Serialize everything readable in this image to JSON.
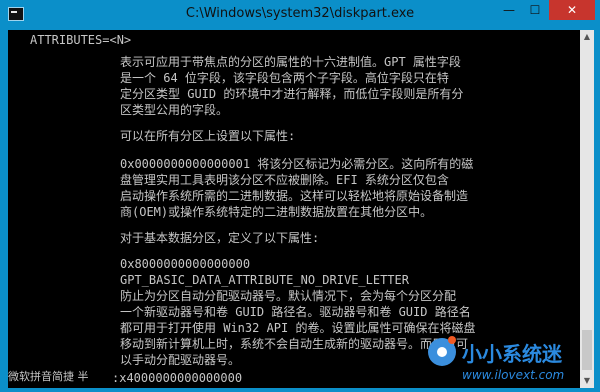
{
  "window": {
    "title": "C:\\Windows\\system32\\diskpart.exe",
    "buttons": {
      "minimize": "—",
      "maximize": "☐",
      "close": "✕"
    }
  },
  "console": {
    "lines": [
      "ATTRIBUTES=<N>",
      "表示可应用于带焦点的分区的属性的十六进制值。GPT 属性字段",
      "是一个 64 位字段，该字段包含两个子字段。高位字段只在特",
      "定分区类型 GUID 的环境中才进行解释，而低位字段则是所有分",
      "区类型公用的字段。",
      "可以在所有分区上设置以下属性:",
      "0x0000000000000001 将该分区标记为必需分区。这向所有的磁",
      "盘管理实用工具表明该分区不应被删除。EFI 系统分区仅包含",
      "启动操作系统所需的二进制数据。这样可以轻松地将原始设备制造",
      "商(OEM)或操作系统特定的二进制数据放置在其他分区中。",
      "对于基本数据分区，定义了以下属性:",
      "0x8000000000000000",
      "GPT_BASIC_DATA_ATTRIBUTE_NO_DRIVE_LETTER",
      "防止为分区自动分配驱动器号。默认情况下，会为每个分区分配",
      "一个新驱动器号和卷 GUID 路径名。驱动器号和卷 GUID 路径名",
      "都可用于打开使用 Win32 API 的卷。设置此属性可确保在将磁盘",
      "移动到新计算机上时，系统不会自动生成新的驱动器号。而用户可",
      "以手动分配驱动器号。",
      ":x4000000000000000"
    ]
  },
  "ime": {
    "text": "微软拼音简捷 半"
  },
  "watermark": {
    "brand": "小小系统迷",
    "url": "www.ilovext.com"
  },
  "colors": {
    "titlebar": "#0b8fc9",
    "console_bg": "#000000",
    "console_text": "#c6c6c6",
    "close": "#c7352d",
    "logo": "#2b8ae0"
  }
}
